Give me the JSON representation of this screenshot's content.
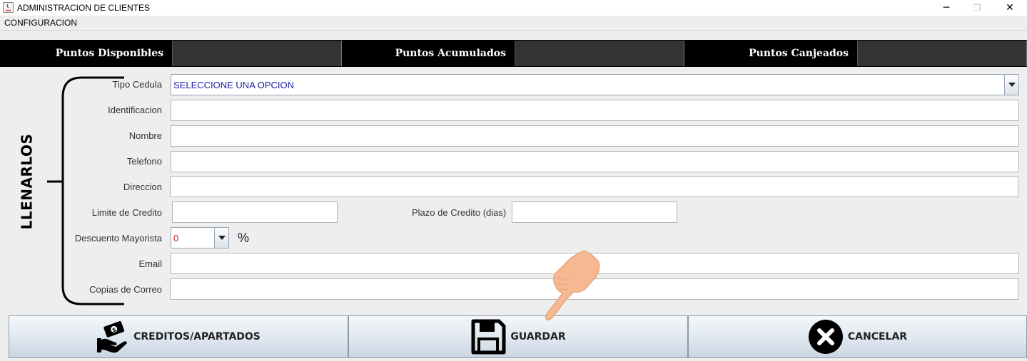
{
  "window": {
    "title": "ADMINISTRACION DE CLIENTES",
    "minimize_glyph": "─",
    "restore_glyph": "❐",
    "close_glyph": "✕"
  },
  "menu": {
    "items": [
      "CONFIGURACION"
    ]
  },
  "points": [
    {
      "label": "Puntos Disponibles",
      "value": ""
    },
    {
      "label": "Puntos Acumulados",
      "value": ""
    },
    {
      "label": "Puntos Canjeados",
      "value": ""
    }
  ],
  "form": {
    "side_label": "LLENARLOS",
    "tipo_cedula": {
      "label": "Tipo Cedula",
      "value": "SELECCIONE UNA OPCION",
      "color": "#1d1da8"
    },
    "identificacion": {
      "label": "Identificacion",
      "value": ""
    },
    "nombre": {
      "label": "Nombre",
      "value": ""
    },
    "telefono": {
      "label": "Telefono",
      "value": ""
    },
    "direccion": {
      "label": "Direccion",
      "value": ""
    },
    "limite_credito": {
      "label": "Limite de Credito",
      "value": ""
    },
    "plazo_credito": {
      "label": "Plazo de Credito (dias)",
      "value": ""
    },
    "descuento_mayorista": {
      "label": "Descuento Mayorista",
      "value": "0",
      "color": "#c8201c",
      "unit": "%"
    },
    "email": {
      "label": "Email",
      "value": ""
    },
    "copias_correo": {
      "label": "Copias de Correo",
      "value": ""
    }
  },
  "buttons": {
    "creditos": {
      "label": "CREDITOS/APARTADOS",
      "icon": "hand-money-icon"
    },
    "guardar": {
      "label": "GUARDAR",
      "icon": "floppy-disk-icon"
    },
    "cancelar": {
      "label": "CANCELAR",
      "icon": "close-circle-icon"
    }
  },
  "colors": {
    "points_bar": "#000000",
    "points_value_bg": "#333333",
    "pointer_hand": "#f6b890"
  }
}
